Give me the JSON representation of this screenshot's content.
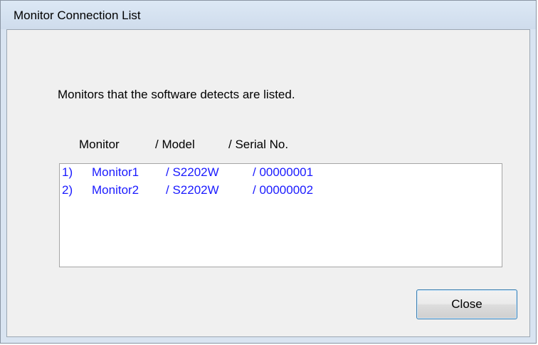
{
  "window": {
    "title": "Monitor Connection List"
  },
  "dialog": {
    "instruction": "Monitors that the software detects are listed.",
    "columns": {
      "monitor": "Monitor",
      "model": "/ Model",
      "serial": "/ Serial No."
    },
    "list": [
      {
        "index": "1)",
        "monitor": "Monitor1",
        "model": "/ S2202W",
        "serial": "/ 00000001"
      },
      {
        "index": "2)",
        "monitor": "Monitor2",
        "model": "/ S2202W",
        "serial": "/ 00000002"
      }
    ],
    "close_label": "Close"
  },
  "colors": {
    "list_text": "#1a1aff",
    "button_border": "#3c7fb1"
  }
}
